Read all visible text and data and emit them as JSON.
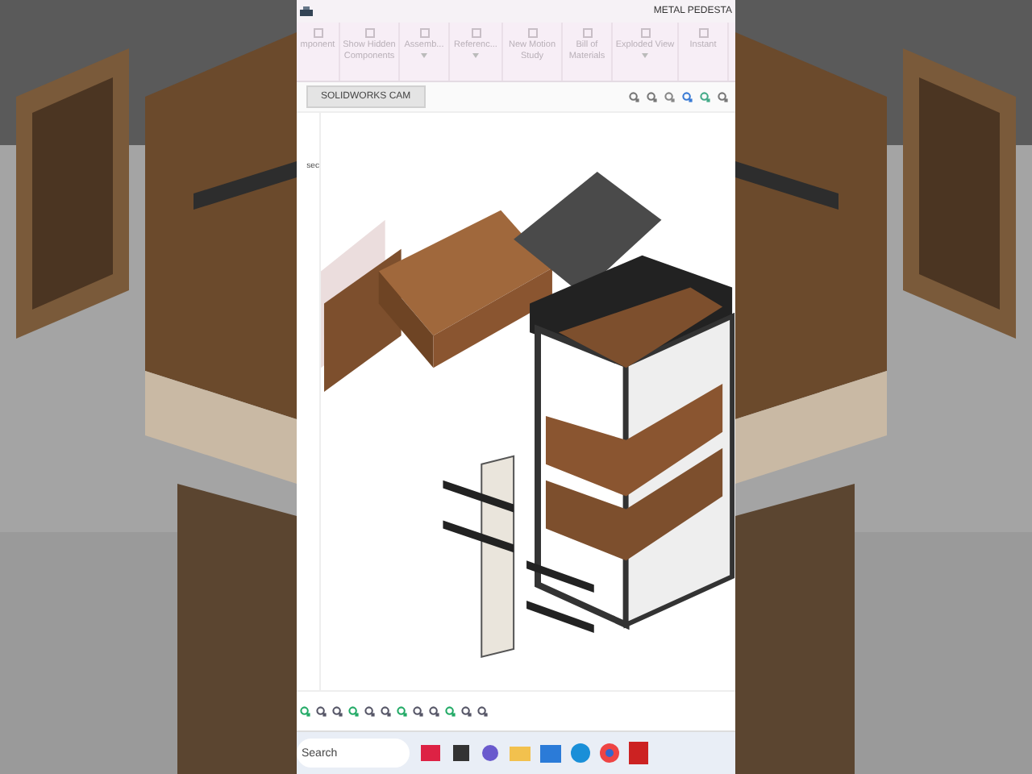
{
  "title_bar": {
    "title": "METAL PEDESTA"
  },
  "ribbon": {
    "items": [
      {
        "label": "mponent",
        "has_menu": false
      },
      {
        "label": "Show Hidden Components",
        "has_menu": false
      },
      {
        "label": "Assemb...",
        "has_menu": true
      },
      {
        "label": "Referenc...",
        "has_menu": true
      },
      {
        "label": "New Motion Study",
        "has_menu": false
      },
      {
        "label": "Bill of Materials",
        "has_menu": false
      },
      {
        "label": "Exploded View",
        "has_menu": true
      },
      {
        "label": "Instant",
        "has_menu": false
      }
    ]
  },
  "tabs": [
    {
      "label": "SOLIDWORKS CAM",
      "selected": true
    }
  ],
  "panel": {
    "label": "sec"
  },
  "taskbar": {
    "search": {
      "placeholder": "Search"
    }
  }
}
